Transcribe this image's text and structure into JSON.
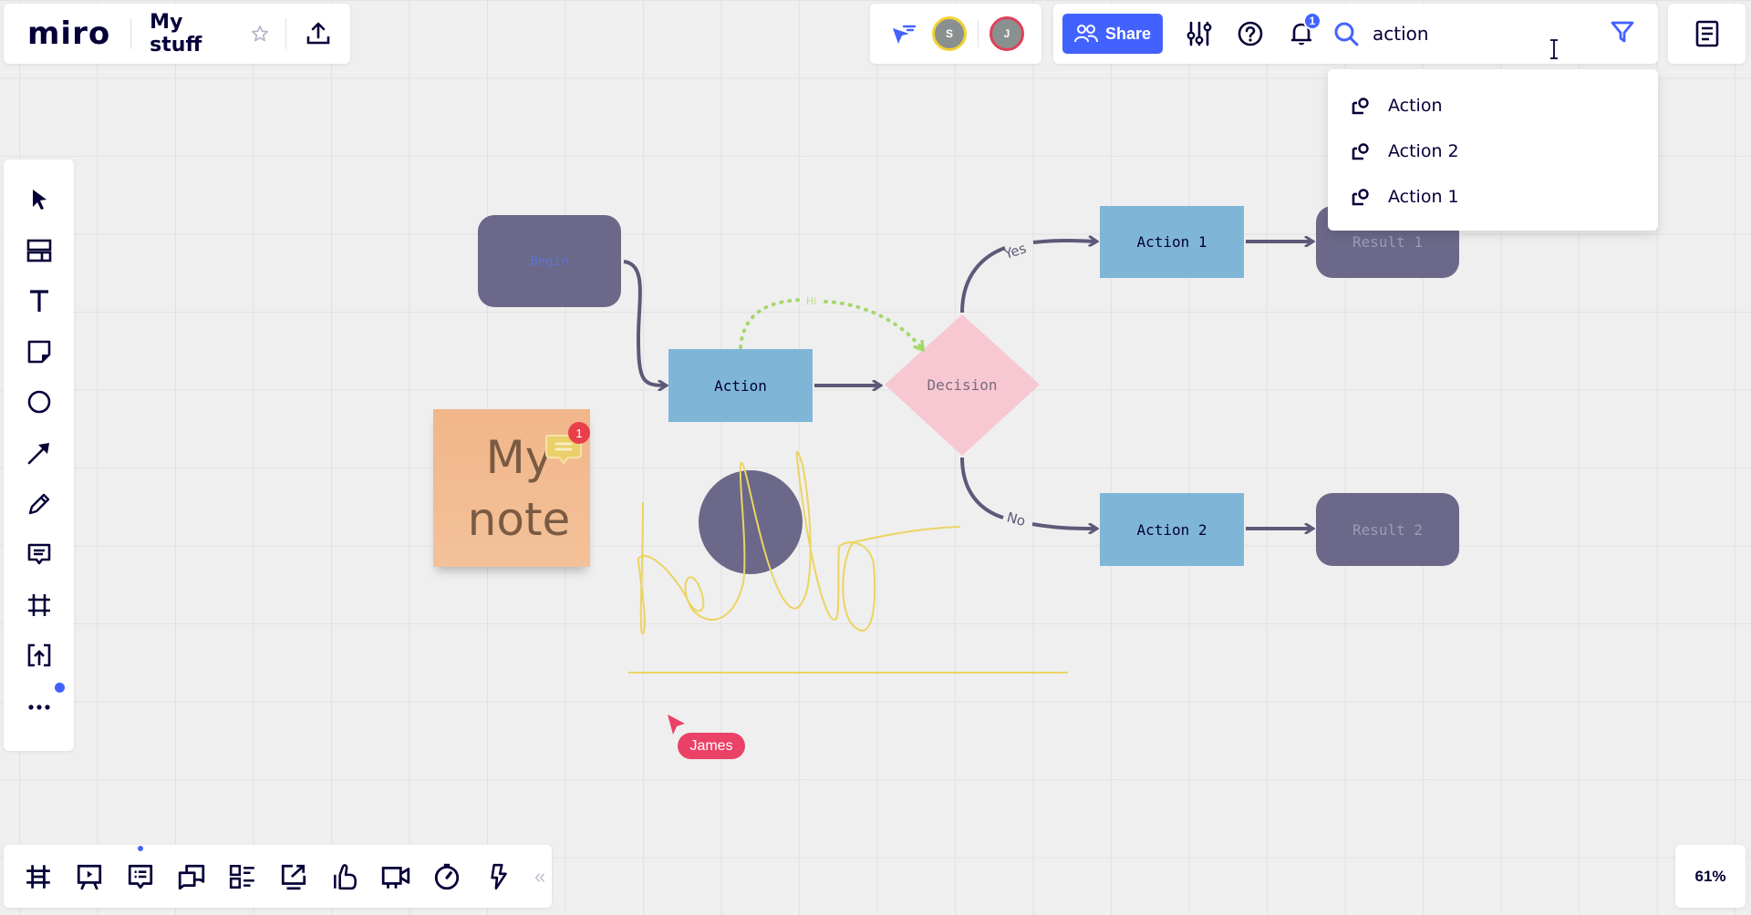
{
  "app": {
    "logo": "miro",
    "board_title": "My stuff"
  },
  "collaborators": [
    {
      "initial": "S",
      "ring_color": "#f2d232"
    },
    {
      "initial": "J",
      "ring_color": "#e04058"
    }
  ],
  "toolbar": {
    "share_label": "Share",
    "notification_count": "1",
    "search": {
      "value": "action",
      "placeholder": "Search"
    }
  },
  "search_results": [
    {
      "label": "Action",
      "icon": "shape-icon"
    },
    {
      "label": "Action 2",
      "icon": "shape-icon"
    },
    {
      "label": "Action 1",
      "icon": "shape-icon"
    }
  ],
  "left_tools": [
    {
      "name": "select",
      "icon": "cursor-arrow-icon"
    },
    {
      "name": "templates",
      "icon": "templates-icon"
    },
    {
      "name": "text",
      "icon": "text-icon"
    },
    {
      "name": "sticky-note",
      "icon": "sticky-note-icon"
    },
    {
      "name": "shapes",
      "icon": "circle-shape-icon"
    },
    {
      "name": "connection-line",
      "icon": "arrow-line-icon"
    },
    {
      "name": "pen",
      "icon": "pen-icon"
    },
    {
      "name": "comment",
      "icon": "comment-icon"
    },
    {
      "name": "frame",
      "icon": "frame-icon"
    },
    {
      "name": "upload",
      "icon": "upload-icon"
    },
    {
      "name": "more-tools",
      "icon": "more-dots-icon"
    }
  ],
  "bottom_tools": [
    {
      "name": "frames",
      "icon": "frames-icon"
    },
    {
      "name": "presentation",
      "icon": "presentation-icon"
    },
    {
      "name": "comments",
      "icon": "comments-list-icon"
    },
    {
      "name": "chat",
      "icon": "chat-icon"
    },
    {
      "name": "cards",
      "icon": "cards-icon"
    },
    {
      "name": "share-screen",
      "icon": "screen-share-icon"
    },
    {
      "name": "voting",
      "icon": "thumbs-up-icon"
    },
    {
      "name": "video-call",
      "icon": "video-camera-icon"
    },
    {
      "name": "timer",
      "icon": "timer-icon"
    },
    {
      "name": "apps",
      "icon": "lightning-icon"
    }
  ],
  "collapse_label": "«",
  "zoom_level": "61%",
  "canvas": {
    "nodes": {
      "begin": "Begin",
      "action": "Action",
      "decision": "Decision",
      "action1": "Action 1",
      "action2": "Action 2",
      "result1": "Result 1",
      "result2": "Result 2"
    },
    "connector_labels": {
      "yes": "Yes",
      "no": "No",
      "hi": "Hi"
    },
    "sticky_note": {
      "text": "My note",
      "comment_count": "1"
    },
    "handwriting": "hello",
    "remote_cursor": {
      "user": "James",
      "color": "#e94266"
    }
  },
  "colors": {
    "accent": "#4262ff",
    "action_fill": "#7fb6d8",
    "terminal_fill": "#6b6889",
    "decision_fill": "#f7c8d2",
    "sticky_fill": "#f1b68a",
    "connector": "#5c5a78",
    "pen_stroke": "#ecd462"
  }
}
